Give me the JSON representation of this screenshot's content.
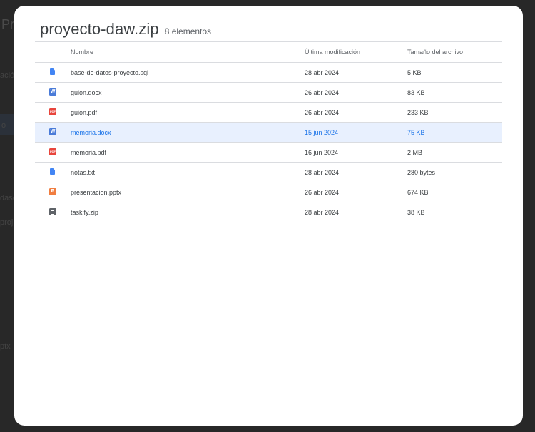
{
  "modal": {
    "title": "proyecto-daw.zip",
    "count": "8 elementos"
  },
  "columns": {
    "name": "Nombre",
    "modified": "Última modificación",
    "size": "Tamaño del archivo"
  },
  "files": [
    {
      "name": "base-de-datos-proyecto.sql",
      "modified": "28 abr 2024",
      "size": "5 KB",
      "icon": "text-document-icon"
    },
    {
      "name": "guion.docx",
      "modified": "26 abr 2024",
      "size": "83 KB",
      "icon": "word-icon"
    },
    {
      "name": "guion.pdf",
      "modified": "26 abr 2024",
      "size": "233 KB",
      "icon": "pdf-icon"
    },
    {
      "name": "memoria.docx",
      "modified": "15 jun 2024",
      "size": "75 KB",
      "icon": "word-icon",
      "selected": true
    },
    {
      "name": "memoria.pdf",
      "modified": "16 jun 2024",
      "size": "2 MB",
      "icon": "pdf-icon"
    },
    {
      "name": "notas.txt",
      "modified": "28 abr 2024",
      "size": "280 bytes",
      "icon": "text-document-icon"
    },
    {
      "name": "presentacion.pptx",
      "modified": "26 abr 2024",
      "size": "674 KB",
      "icon": "powerpoint-icon"
    },
    {
      "name": "taskify.zip",
      "modified": "28 abr 2024",
      "size": "38 KB",
      "icon": "zip-icon"
    }
  ],
  "background": {
    "title_fragment": "Pr",
    "fragments": [
      "ació",
      "o",
      "dase",
      "proj",
      "ptx"
    ]
  },
  "colors": {
    "selected_row_bg": "#e8f0fe",
    "selected_text": "#1a73e8",
    "word": "#4a7bd8",
    "pdf": "#e8453c",
    "doc": "#4285f4",
    "ppt": "#f07d40",
    "zip": "#5f6368"
  }
}
